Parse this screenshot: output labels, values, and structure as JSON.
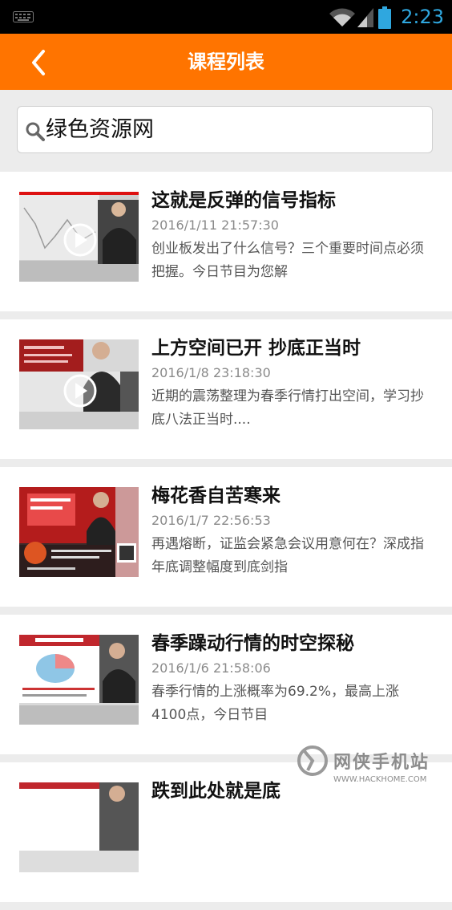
{
  "status_bar": {
    "time": "2:23"
  },
  "header": {
    "title": "课程列表"
  },
  "search": {
    "value": "绿色资源网"
  },
  "courses": [
    {
      "title": "这就是反弹的信号指标",
      "date": "2016/1/11 21:57:30",
      "description": "创业板发出了什么信号？三个重要时间点必须把握。今日节目为您解"
    },
    {
      "title": "上方空间已开 抄底正当时",
      "date": "2016/1/8 23:18:30",
      "description": "近期的震荡整理为春季行情打出空间，学习抄底八法正当时...."
    },
    {
      "title": "梅花香自苦寒来",
      "date": "2016/1/7 22:56:53",
      "description": "再遇熔断，证监会紧急会议用意何在？深成指年底调整幅度到底剑指"
    },
    {
      "title": "春季躁动行情的时空探秘",
      "date": "2016/1/6 21:58:06",
      "description": "春季行情的上涨概率为69.2%，最高上涨4100点，今日节目"
    },
    {
      "title": "跌到此处就是底",
      "date": "",
      "description": ""
    }
  ],
  "watermark": {
    "name": "网侠手机站",
    "url": "WWW.HACKHOME.COM"
  },
  "colors": {
    "accent": "#ff7400",
    "status_text": "#2fa7df"
  }
}
